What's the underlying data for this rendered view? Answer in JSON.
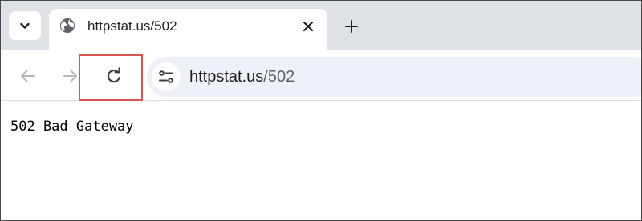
{
  "tab": {
    "title": "httpstat.us/502",
    "favicon": "globe-icon"
  },
  "toolbar": {
    "back_icon": "arrow-left-icon",
    "forward_icon": "arrow-right-icon",
    "reload_icon": "reload-icon",
    "site_info_icon": "tune-icon"
  },
  "omnibox": {
    "host": "httpstat.us",
    "path": "/502"
  },
  "page": {
    "body_text": "502 Bad Gateway"
  },
  "colors": {
    "tabstrip_bg": "#dee1e6",
    "omnibox_bg": "#eef1f8",
    "highlight_border": "#d9534f"
  }
}
